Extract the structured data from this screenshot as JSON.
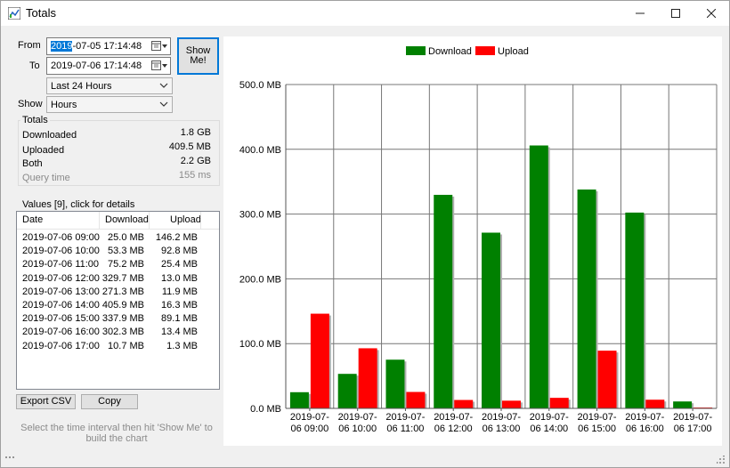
{
  "window": {
    "title": "Totals",
    "minimize_icon": "minimize-icon",
    "maximize_icon": "maximize-icon",
    "close_icon": "close-icon"
  },
  "controls": {
    "from_label": "From",
    "from_value_selected": "2019",
    "from_value_rest": "-07-05 17:14:48",
    "to_label": "To",
    "to_value": "2019-07-06 17:14:48",
    "range_select": "Last 24 Hours",
    "show_label": "Show",
    "show_select": "Hours",
    "show_me_button": "Show Me!"
  },
  "totals": {
    "group_title": "Totals",
    "downloaded_label": "Downloaded",
    "downloaded_value": "1.8 GB",
    "uploaded_label": "Uploaded",
    "uploaded_value": "409.5 MB",
    "both_label": "Both",
    "both_value": "2.2 GB",
    "query_time_label": "Query time",
    "query_time_value": "155 ms"
  },
  "values_list": {
    "caption": "Values [9], click for details",
    "columns": [
      "Date",
      "Download",
      "Upload"
    ],
    "rows": [
      [
        "2019-07-06 09:00",
        "25.0 MB",
        "146.2 MB"
      ],
      [
        "2019-07-06 10:00",
        "53.3 MB",
        "92.8 MB"
      ],
      [
        "2019-07-06 11:00",
        "75.2 MB",
        "25.4 MB"
      ],
      [
        "2019-07-06 12:00",
        "329.7 MB",
        "13.0 MB"
      ],
      [
        "2019-07-06 13:00",
        "271.3 MB",
        "11.9 MB"
      ],
      [
        "2019-07-06 14:00",
        "405.9 MB",
        "16.3 MB"
      ],
      [
        "2019-07-06 15:00",
        "337.9 MB",
        "89.1 MB"
      ],
      [
        "2019-07-06 16:00",
        "302.3 MB",
        "13.4 MB"
      ],
      [
        "2019-07-06 17:00",
        "10.7 MB",
        "1.3 MB"
      ]
    ]
  },
  "actions": {
    "export_csv": "Export CSV",
    "copy": "Copy",
    "hint": "Select the time interval then hit 'Show Me' to build the chart"
  },
  "colors": {
    "download": "#008000",
    "upload": "#ff0000",
    "selection": "#0078d7"
  },
  "chart_data": {
    "type": "bar",
    "categories": [
      "2019-07-06 09:00",
      "2019-07-06 10:00",
      "2019-07-06 11:00",
      "2019-07-06 12:00",
      "2019-07-06 13:00",
      "2019-07-06 14:00",
      "2019-07-06 15:00",
      "2019-07-06 16:00",
      "2019-07-06 17:00"
    ],
    "series": [
      {
        "name": "Download",
        "values": [
          25.0,
          53.3,
          75.2,
          329.7,
          271.3,
          405.9,
          337.9,
          302.3,
          10.7
        ]
      },
      {
        "name": "Upload",
        "values": [
          146.2,
          92.8,
          25.4,
          13.0,
          11.9,
          16.3,
          89.1,
          13.4,
          1.3
        ]
      }
    ],
    "y_ticks": [
      "500.0 MB",
      "400.0 MB",
      "300.0 MB",
      "200.0 MB",
      "100.0 MB",
      "0.0 MB"
    ],
    "x_tick_labels": [
      [
        "2019-07-",
        "06 09:00"
      ],
      [
        "2019-07-",
        "06 10:00"
      ],
      [
        "2019-07-",
        "06 11:00"
      ],
      [
        "2019-07-",
        "06 12:00"
      ],
      [
        "2019-07-",
        "06 13:00"
      ],
      [
        "2019-07-",
        "06 14:00"
      ],
      [
        "2019-07-",
        "06 15:00"
      ],
      [
        "2019-07-",
        "06 16:00"
      ],
      [
        "2019-07-",
        "06 17:00"
      ]
    ],
    "ylim": [
      0,
      500
    ],
    "grid": true,
    "legend_position": "top-center"
  }
}
